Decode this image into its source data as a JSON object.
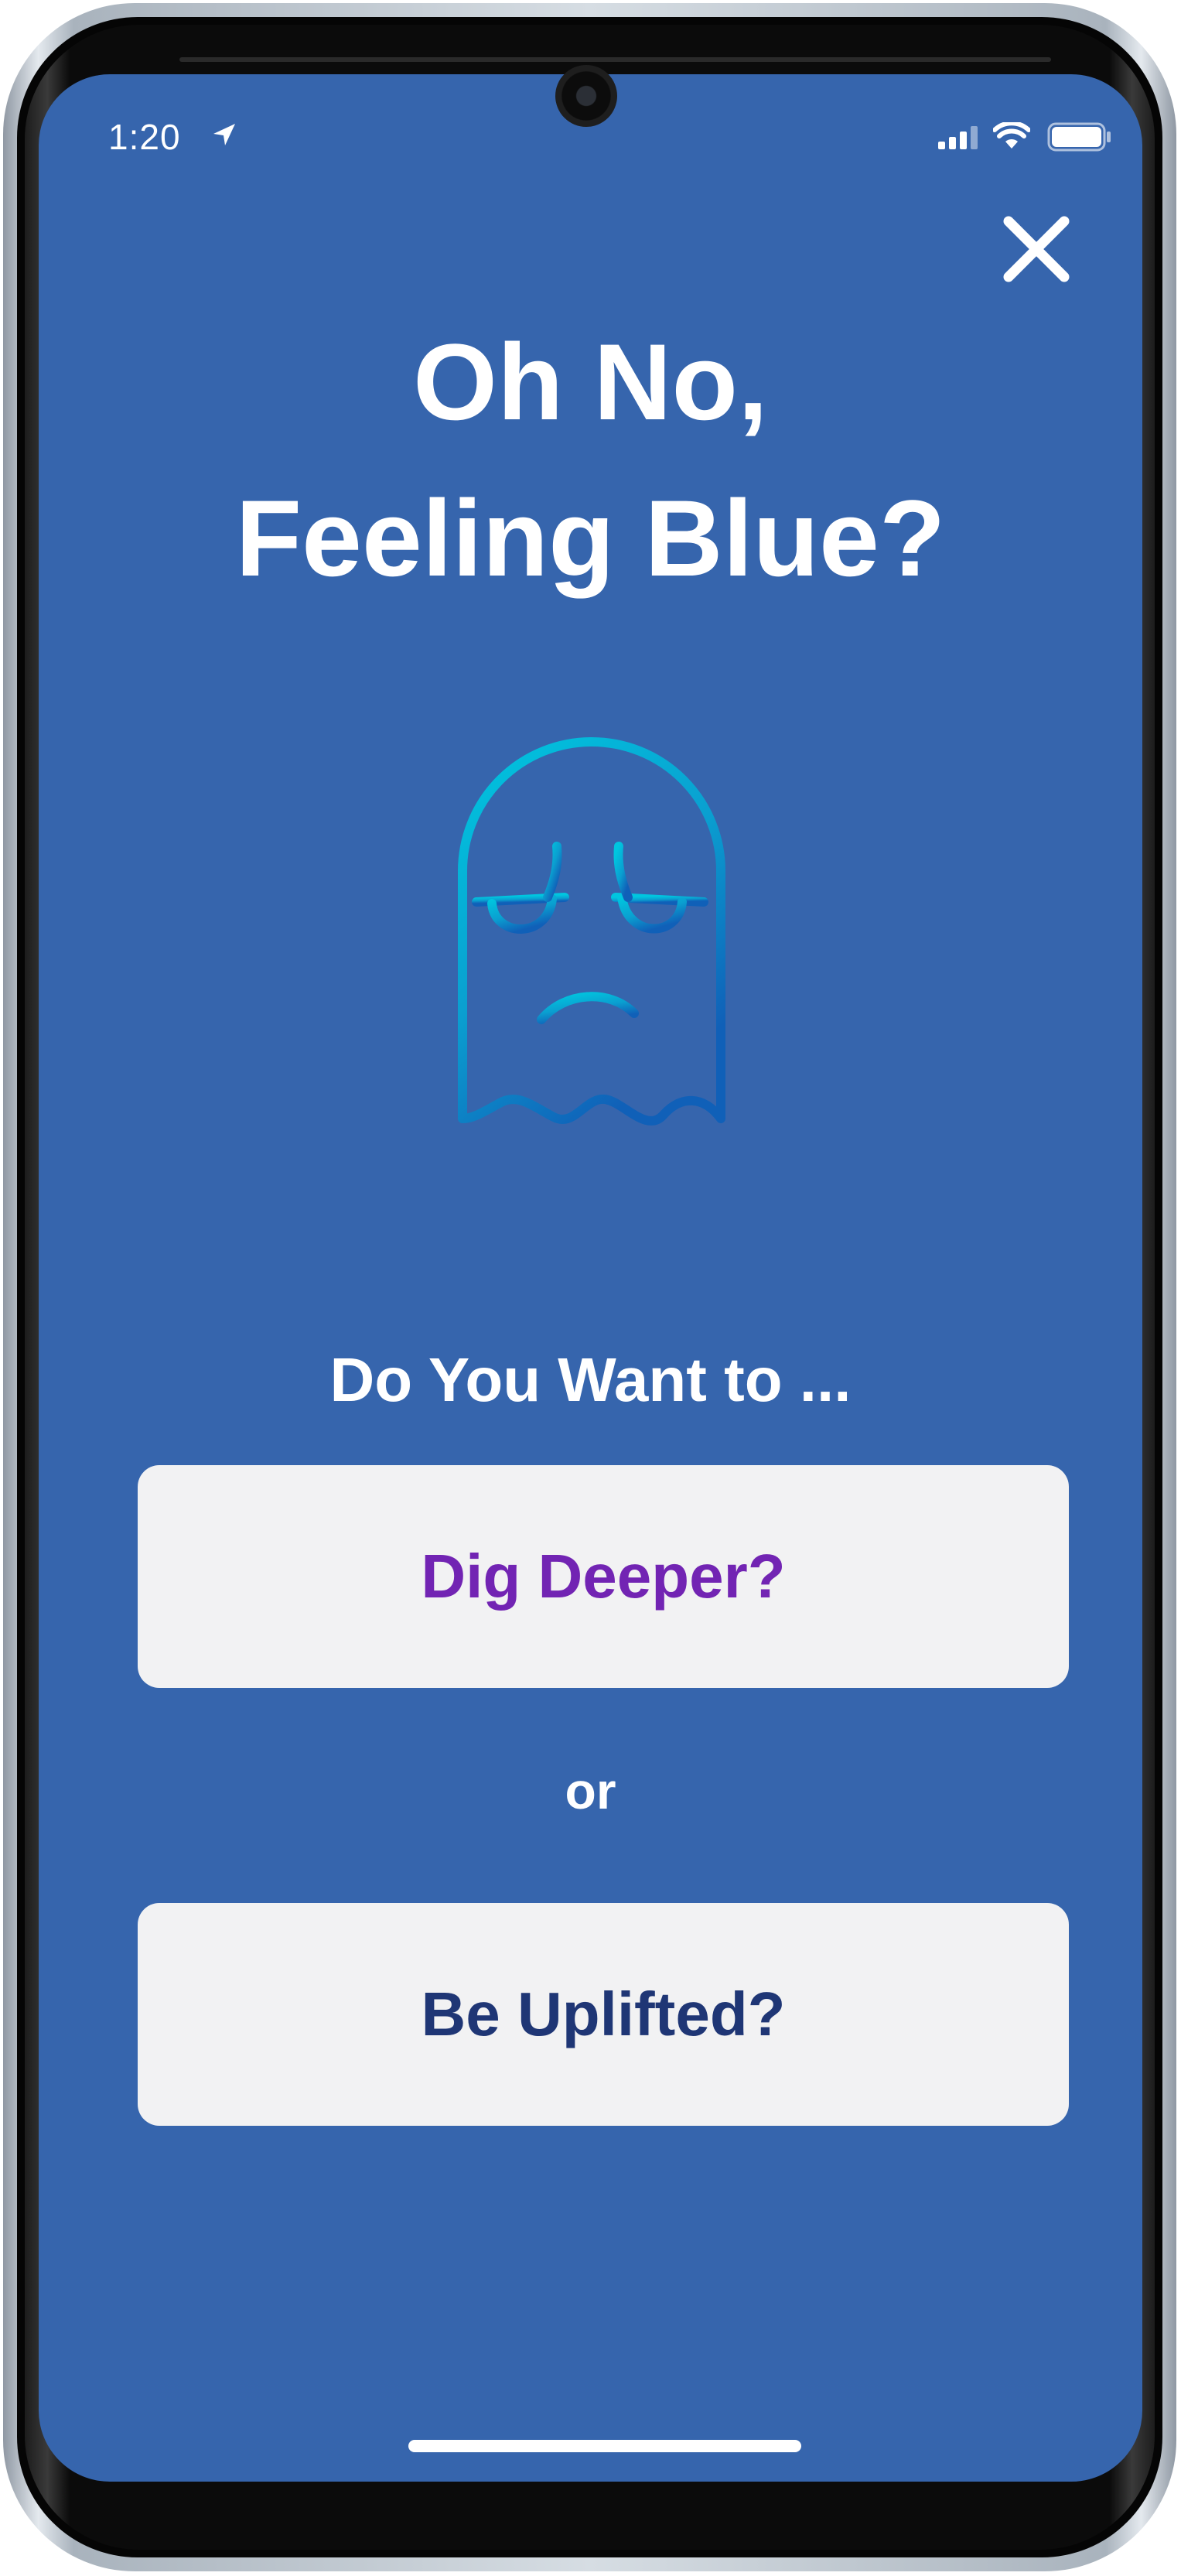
{
  "status_bar": {
    "time": "1:20",
    "icons": [
      "location-arrow-icon",
      "signal-icon",
      "wifi-icon",
      "battery-icon"
    ]
  },
  "close": {
    "icon": "close-icon"
  },
  "title": {
    "line1": "Oh No,",
    "line2": "Feeling Blue?"
  },
  "illustration": {
    "icon": "sad-ghost-icon",
    "gradient": [
      "#00c6df",
      "#1060b8"
    ]
  },
  "prompt": "Do You Want to ...",
  "options": {
    "dig_deeper": "Dig Deeper?",
    "separator": "or",
    "be_uplifted": "Be Uplifted?"
  },
  "colors": {
    "background": "#3665ad",
    "button_bg": "#f2f2f3",
    "dig_deeper_text": "#7224b3",
    "be_uplifted_text": "#1f3675",
    "text": "#ffffff"
  }
}
